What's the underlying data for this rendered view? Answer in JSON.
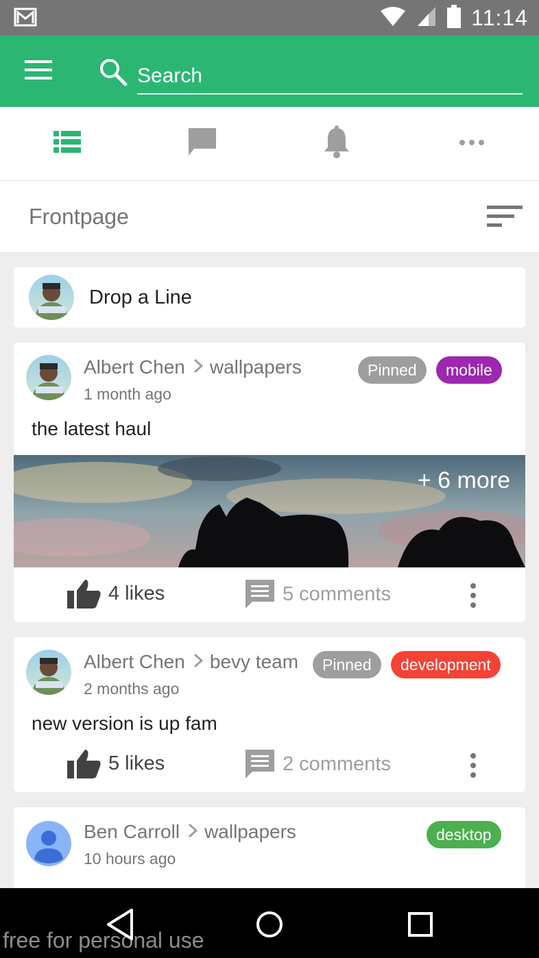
{
  "status_bar": {
    "time": "11:14",
    "notification_icon": "gmail-icon",
    "wifi_icon": "wifi-icon",
    "signal_icon": "signal-icon",
    "battery_icon": "battery-icon"
  },
  "app_bar": {
    "search_placeholder": "Search",
    "color": "#2bb673"
  },
  "tabs": [
    {
      "icon": "list-icon",
      "active": true
    },
    {
      "icon": "chat-icon",
      "active": false
    },
    {
      "icon": "bell-icon",
      "active": false
    },
    {
      "icon": "more-horizontal-icon",
      "active": false
    }
  ],
  "page": {
    "title": "Frontpage",
    "sort_icon": "sort-icon"
  },
  "composer": {
    "label": "Drop a Line"
  },
  "posts": [
    {
      "author": "Albert Chen",
      "board": "wallpapers",
      "time": "1 month ago",
      "badges": [
        {
          "label": "Pinned",
          "color": "#9e9e9e"
        },
        {
          "label": "mobile",
          "color": "#9c27b0"
        }
      ],
      "text": "the latest haul",
      "more_images": "+ 6 more",
      "likes": "4 likes",
      "comments": "5 comments"
    },
    {
      "author": "Albert Chen",
      "board": "bevy team",
      "time": "2 months ago",
      "badges": [
        {
          "label": "Pinned",
          "color": "#9e9e9e"
        },
        {
          "label": "development",
          "color": "#f44336"
        }
      ],
      "text": "new version is up fam",
      "likes": "5 likes",
      "comments": "2 comments"
    },
    {
      "author": "Ben Carroll",
      "board": "wallpapers",
      "time": "10 hours ago",
      "badges": [
        {
          "label": "desktop",
          "color": "#4caf50"
        }
      ]
    }
  ],
  "watermark": "free for personal use"
}
